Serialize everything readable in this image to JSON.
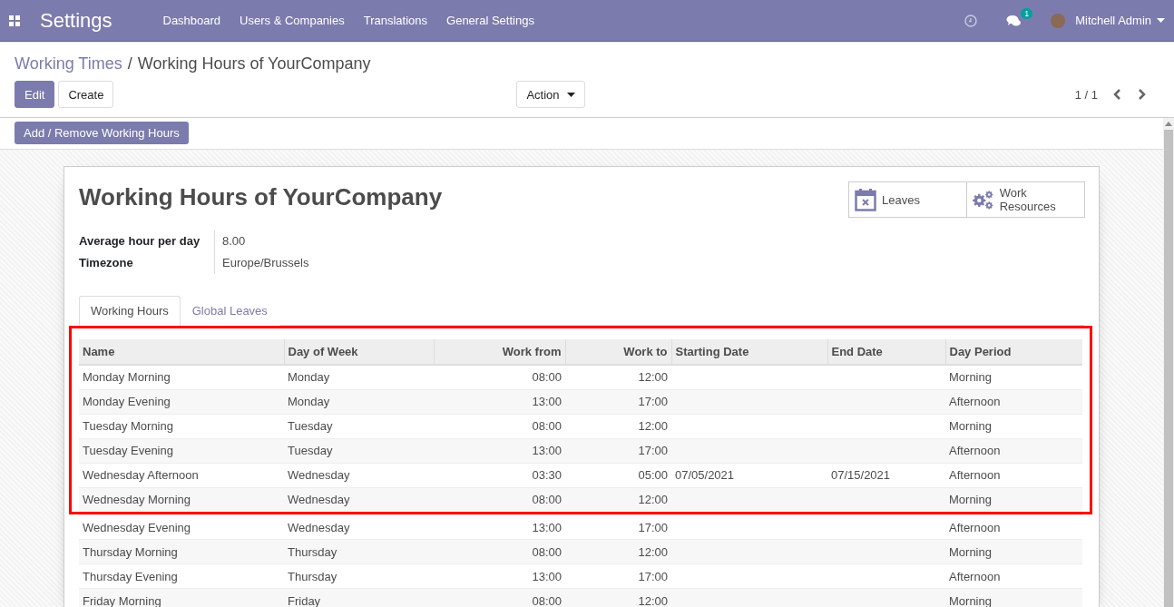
{
  "navbar": {
    "app_title": "Settings",
    "menu": [
      "Dashboard",
      "Users & Companies",
      "Translations",
      "General Settings"
    ],
    "messages_badge": "1",
    "user": "Mitchell Admin"
  },
  "breadcrumb": {
    "parent": "Working Times",
    "separator": "/",
    "current": "Working Hours of YourCompany"
  },
  "buttons": {
    "edit": "Edit",
    "create": "Create",
    "action": "Action"
  },
  "pager": "1 / 1",
  "header_button": "Add / Remove Working Hours",
  "form": {
    "title": "Working Hours of YourCompany",
    "smart_buttons": [
      {
        "kind": "calendar",
        "label": "Leaves"
      },
      {
        "kind": "gears",
        "label": "Work Resources"
      }
    ],
    "fields": [
      {
        "label": "Average hour per day",
        "value": "8.00"
      },
      {
        "label": "Timezone",
        "value": "Europe/Brussels"
      }
    ],
    "tabs": [
      {
        "label": "Working Hours",
        "selected": true
      },
      {
        "label": "Global Leaves",
        "selected": false
      }
    ],
    "table": {
      "columns": [
        {
          "label": "Name",
          "kind": "text"
        },
        {
          "label": "Day of Week",
          "kind": "text"
        },
        {
          "label": "Work from",
          "kind": "time"
        },
        {
          "label": "Work to",
          "kind": "time"
        },
        {
          "label": "Starting Date",
          "kind": "date"
        },
        {
          "label": "End Date",
          "kind": "date"
        },
        {
          "label": "Day Period",
          "kind": "text"
        }
      ],
      "rows": [
        {
          "highlighted": true,
          "cells": [
            "Monday Morning",
            "Monday",
            "08:00",
            "12:00",
            "",
            "",
            "Morning"
          ]
        },
        {
          "highlighted": true,
          "cells": [
            "Monday Evening",
            "Monday",
            "13:00",
            "17:00",
            "",
            "",
            "Afternoon"
          ]
        },
        {
          "highlighted": true,
          "cells": [
            "Tuesday Morning",
            "Tuesday",
            "08:00",
            "12:00",
            "",
            "",
            "Morning"
          ]
        },
        {
          "highlighted": true,
          "cells": [
            "Tuesday Evening",
            "Tuesday",
            "13:00",
            "17:00",
            "",
            "",
            "Afternoon"
          ]
        },
        {
          "highlighted": true,
          "cells": [
            "Wednesday Afternoon",
            "Wednesday",
            "03:30",
            "05:00",
            "07/05/2021",
            "07/15/2021",
            "Afternoon"
          ]
        },
        {
          "highlighted": true,
          "cells": [
            "Wednesday Morning",
            "Wednesday",
            "08:00",
            "12:00",
            "",
            "",
            "Morning"
          ]
        },
        {
          "highlighted": false,
          "cells": [
            "Wednesday Evening",
            "Wednesday",
            "13:00",
            "17:00",
            "",
            "",
            "Afternoon"
          ]
        },
        {
          "highlighted": false,
          "cells": [
            "Thursday Morning",
            "Thursday",
            "08:00",
            "12:00",
            "",
            "",
            "Morning"
          ]
        },
        {
          "highlighted": false,
          "cells": [
            "Thursday Evening",
            "Thursday",
            "13:00",
            "17:00",
            "",
            "",
            "Afternoon"
          ]
        },
        {
          "highlighted": false,
          "cells": [
            "Friday Morning",
            "Friday",
            "08:00",
            "12:00",
            "",
            "",
            "Morning"
          ]
        }
      ]
    }
  }
}
